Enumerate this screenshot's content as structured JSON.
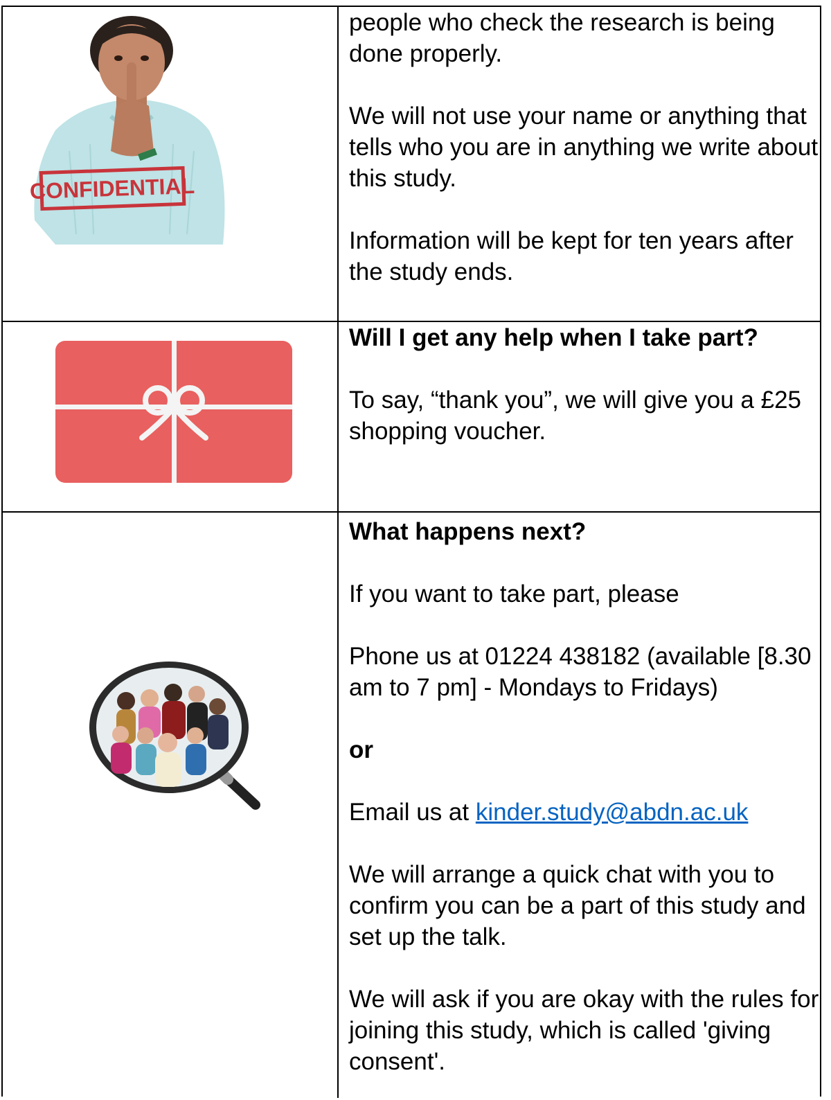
{
  "section1": {
    "image_stamp": "CONFIDENTIAL",
    "para1": "people who check the research is being done properly.",
    "para2": "We will not use your name or anything that tells who you are in anything we write about this study.",
    "para3": "Information will be kept for ten years after the study ends."
  },
  "section2": {
    "heading": "Will I get any help when I take part?",
    "para1": "To say, “thank you”, we will give you a £25 shopping voucher."
  },
  "section3": {
    "heading": "What happens next?",
    "para1": "If you want to take part, please",
    "para2": "Phone us at 01224 438182 (available [8.30 am to 7 pm] - Mondays to Fridays)",
    "or": "or",
    "email_prefix": "Email us at ",
    "email": "kinder.study@abdn.ac.uk",
    "para3": "We will arrange a quick chat with you to confirm you can be a part of this study and set up the talk.",
    "para4": "We will ask if you are okay with the rules for joining this study, which is called 'giving consent'."
  },
  "colors": {
    "border": "#000000",
    "link": "#0563c1",
    "gift_card": "#e8605f",
    "sweater": "#bfe3e6",
    "stamp_red": "#c8343b"
  }
}
